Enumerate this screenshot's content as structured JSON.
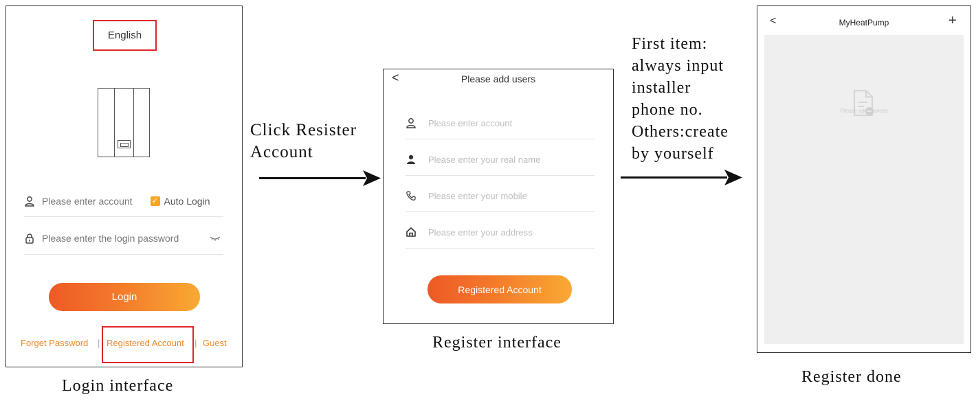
{
  "login": {
    "language": "English",
    "account_placeholder": "Please enter account",
    "auto_login": "Auto Login",
    "password_placeholder": "Please enter the login password",
    "login_button": "Login",
    "forget_password": "Forget Password",
    "registered_account": "Registered Account",
    "guest": "Guest",
    "separator": "|",
    "caption": "Login interface"
  },
  "annotation1": {
    "line1": "Click Resister",
    "line2": "Account"
  },
  "register": {
    "title": "Please add users",
    "back": "<",
    "fields": [
      {
        "icon": "user-outline-icon",
        "placeholder": "Please enter account"
      },
      {
        "icon": "user-filled-icon",
        "placeholder": "Please enter your real name"
      },
      {
        "icon": "phone-icon",
        "placeholder": "Please enter your mobile"
      },
      {
        "icon": "home-icon",
        "placeholder": "Please enter your address"
      }
    ],
    "button": "Registered Account",
    "caption": "Register interface"
  },
  "annotation2": {
    "lines": [
      "First item:",
      "always input",
      "installer",
      "phone no.",
      "Others:create",
      "by yourself"
    ]
  },
  "done": {
    "title": "MyHeatPump",
    "back": "<",
    "add": "+",
    "empty_text": "Please add devices",
    "caption": "Register done"
  },
  "colors": {
    "highlight_red": "#e0262a",
    "accent_orange": "#f08a2a",
    "gradient_start": "#ee5a26",
    "gradient_end": "#f9a934"
  }
}
